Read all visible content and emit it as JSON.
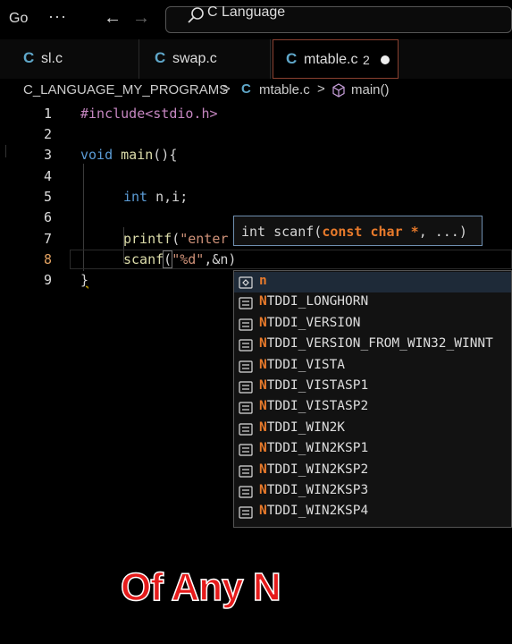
{
  "titlebar": {
    "menu_go": "Go",
    "menu_more": "···",
    "back": "←",
    "forward": "→",
    "search_text": "C Language"
  },
  "tabs": [
    {
      "icon": "C",
      "label": "sl.c"
    },
    {
      "icon": "C",
      "label": "swap.c"
    },
    {
      "icon": "C",
      "label": "mtable.c",
      "badge": "2"
    }
  ],
  "breadcrumb": {
    "folder": "C_LANGUAGE_MY_PROGRAMS",
    "sep1": ">",
    "file_icon": "C",
    "file": "mtable.c",
    "sep2": ">",
    "symbol": "main()"
  },
  "editor": {
    "line_numbers": [
      "1",
      "2",
      "3",
      "4",
      "5",
      "6",
      "7",
      "8",
      "9"
    ],
    "line1": "#include<stdio.h>",
    "line3_kw": "void",
    "line3_fn": "main",
    "line3_rest": "(){",
    "line5_kw": "int",
    "line5_rest": " n,i;",
    "line7_fn": "printf",
    "line7_p": "(",
    "line7_str": "\"enter",
    "line8_fn": "scanf",
    "line8_p": "(",
    "line8_str": "\"%d\"",
    "line8_rest": ",&n)",
    "line9": "}"
  },
  "signature_help": {
    "prefix": "int scanf(",
    "param_kw": "const char *",
    "suffix": ", ...)"
  },
  "suggestions": [
    {
      "first": "n",
      "rest": ""
    },
    {
      "first": "N",
      "rest": "TDDI_LONGHORN"
    },
    {
      "first": "N",
      "rest": "TDDI_VERSION"
    },
    {
      "first": "N",
      "rest": "TDDI_VERSION_FROM_WIN32_WINNT"
    },
    {
      "first": "N",
      "rest": "TDDI_VISTA"
    },
    {
      "first": "N",
      "rest": "TDDI_VISTASP1"
    },
    {
      "first": "N",
      "rest": "TDDI_VISTASP2"
    },
    {
      "first": "N",
      "rest": "TDDI_WIN2K"
    },
    {
      "first": "N",
      "rest": "TDDI_WIN2KSP1"
    },
    {
      "first": "N",
      "rest": "TDDI_WIN2KSP2"
    },
    {
      "first": "N",
      "rest": "TDDI_WIN2KSP3"
    },
    {
      "first": "N",
      "rest": "TDDI_WIN2KSP4"
    }
  ],
  "caption": "Of Any N",
  "colors": {
    "accent": "#e87a2b",
    "tab_active_border": "#8a4030",
    "caption": "#e51b1b"
  }
}
